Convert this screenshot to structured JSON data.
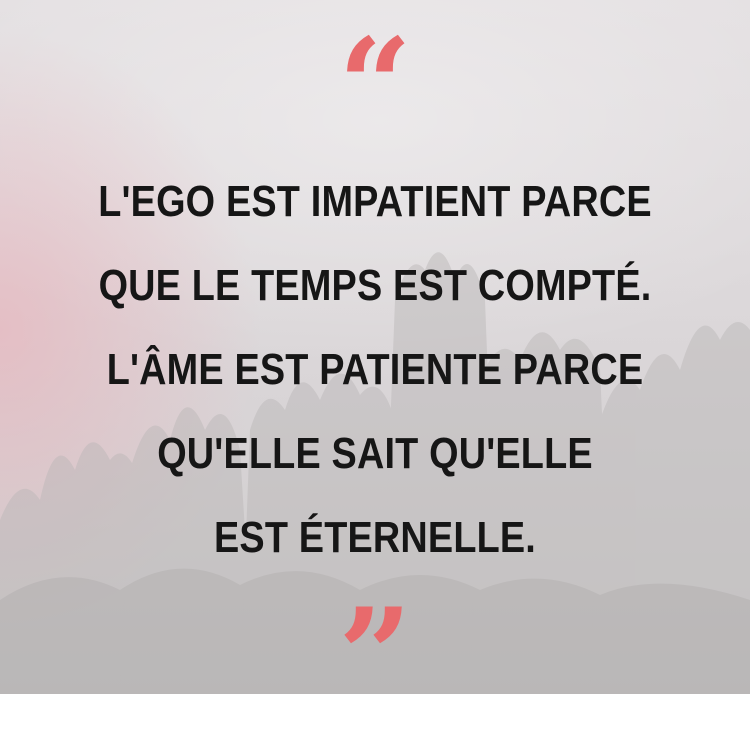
{
  "quote": {
    "open_mark": "“",
    "close_mark": "”",
    "lines": [
      "L'EGO EST IMPATIENT PARCE",
      "QUE LE TEMPS EST COMPTÉ.",
      "L'ÂME EST PATIENTE PARCE",
      "QU'ELLE SAIT QU'ELLE",
      "EST ÉTERNELLE."
    ]
  },
  "colors": {
    "quote_mark": "#e86a6c",
    "text": "#161616",
    "background": "#dedadc",
    "pink_glow": "#ecaab4"
  }
}
